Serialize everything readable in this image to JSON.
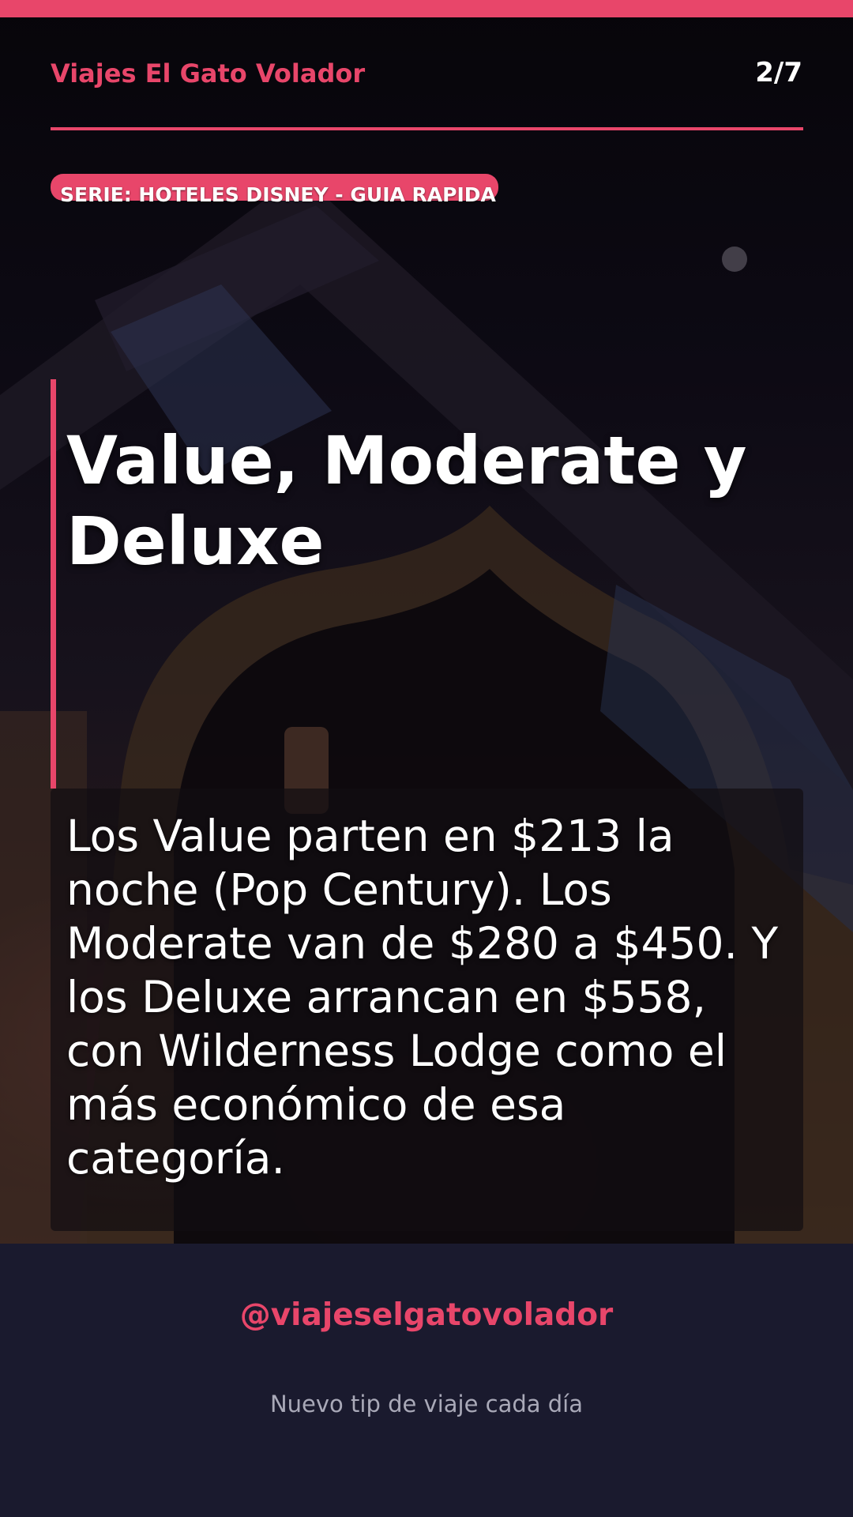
{
  "header": {
    "brand": "Viajes El Gato Volador",
    "page_counter": "2/7"
  },
  "series": {
    "label": "SERIE: HOTELES DISNEY - GUIA RAPIDA"
  },
  "slide": {
    "title": "Value, Moderate y Deluxe",
    "body": "Los Value parten en $213 la noche (Pop Century). Los Moderate van de $280 a $450. Y los Deluxe arrancan en $558, con Wilderness Lodge como el más económico de esa categoría."
  },
  "footer": {
    "handle": "@viajeselgatovolador",
    "tagline": "Nuevo tip de viaje cada día"
  },
  "colors": {
    "accent": "#e8466a",
    "footer_bg": "#1a1a2e",
    "text": "#ffffff"
  }
}
